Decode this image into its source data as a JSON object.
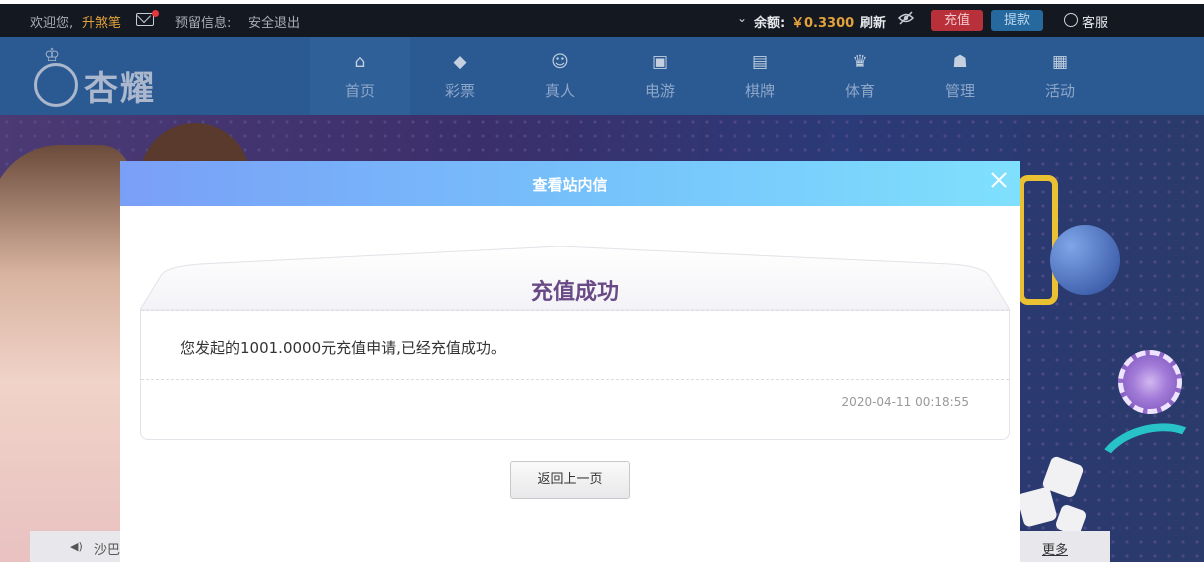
{
  "topbar": {
    "welcome": "欢迎您,",
    "username": "升煞笔",
    "reserve_info": "预留信息:",
    "logout": "安全退出",
    "balance_label": "余额:",
    "balance_value": "￥0.3300",
    "refresh": "刷新",
    "recharge": "充值",
    "withdraw": "提款",
    "customer_service": "客服"
  },
  "logo": {
    "text": "杏耀"
  },
  "nav": {
    "items": [
      {
        "label": "首页",
        "icon": "home-icon",
        "glyph": "⌂"
      },
      {
        "label": "彩票",
        "icon": "lottery-icon",
        "glyph": "◆"
      },
      {
        "label": "真人",
        "icon": "live-dealer-icon",
        "glyph": "☺"
      },
      {
        "label": "电游",
        "icon": "slot-machine-icon",
        "glyph": "▣"
      },
      {
        "label": "棋牌",
        "icon": "cards-icon",
        "glyph": "▤"
      },
      {
        "label": "体育",
        "icon": "trophy-icon",
        "glyph": "♛"
      },
      {
        "label": "管理",
        "icon": "users-icon",
        "glyph": "☗"
      },
      {
        "label": "活动",
        "icon": "gift-icon",
        "glyph": "▦"
      }
    ]
  },
  "newsbar": {
    "text": "沙巴",
    "more": "更多"
  },
  "modal": {
    "title": "查看站内信",
    "message_title": "充值成功",
    "message_body": "您发起的1001.0000元充值申请,已经充值成功。",
    "message_time": "2020-04-11 00:18:55",
    "back_button": "返回上一页"
  },
  "colors": {
    "header_gradient_start": "#7a9ff7",
    "header_gradient_end": "#7fe0fd",
    "message_title": "#6a4a86",
    "recharge_button": "#b8303a",
    "withdraw_button": "#25699e",
    "nav_bg": "#2b5a93"
  }
}
